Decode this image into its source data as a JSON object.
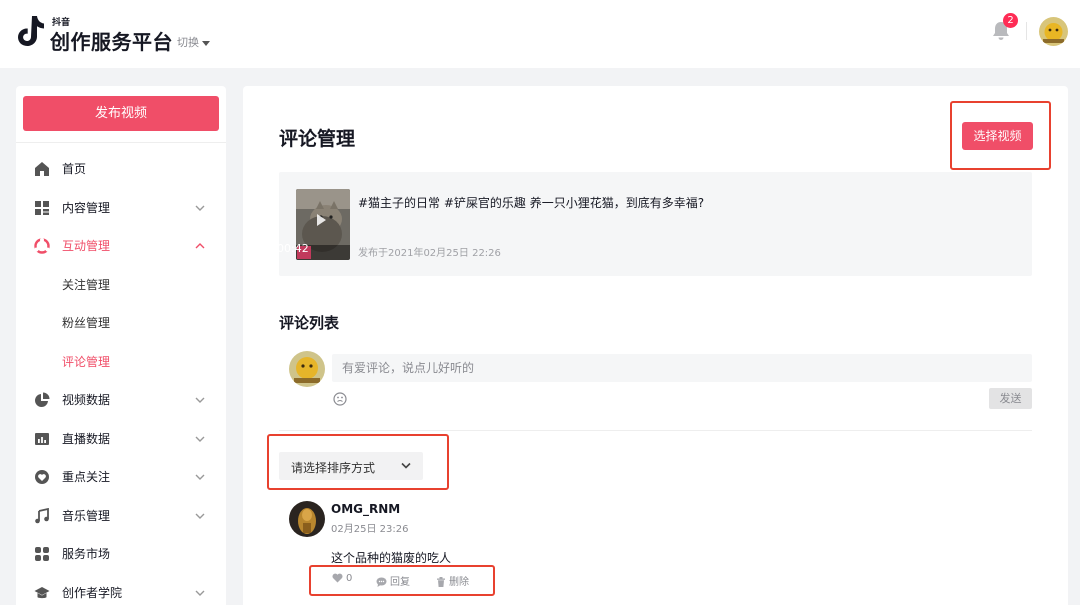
{
  "header": {
    "brand_small": "抖音",
    "brand": "创作服务平台",
    "switch_label": "切换",
    "notification_count": "2"
  },
  "sidebar": {
    "publish_label": "发布视频",
    "items": [
      {
        "label": "首页",
        "icon": "home-icon"
      },
      {
        "label": "内容管理",
        "icon": "grid-icon"
      },
      {
        "label": "互动管理",
        "icon": "interaction-icon"
      },
      {
        "label": "关注管理"
      },
      {
        "label": "粉丝管理"
      },
      {
        "label": "评论管理"
      },
      {
        "label": "视频数据",
        "icon": "pie-chart-icon"
      },
      {
        "label": "直播数据",
        "icon": "bar-chart-icon"
      },
      {
        "label": "重点关注",
        "icon": "heart-icon"
      },
      {
        "label": "音乐管理",
        "icon": "music-icon"
      },
      {
        "label": "服务市场",
        "icon": "apps-icon"
      },
      {
        "label": "创作者学院",
        "icon": "graduation-cap-icon"
      }
    ]
  },
  "main": {
    "page_title": "评论管理",
    "select_video_label": "选择视频",
    "video": {
      "title": "#猫主子的日常 #铲屎官的乐趣 养一只小狸花猫，到底有多幸福?",
      "date": "发布于2021年02月25日 22:26",
      "duration": "00:42"
    },
    "list_title": "评论列表",
    "comment_placeholder": "有爱评论，说点儿好听的",
    "send_label": "发送",
    "sort_placeholder": "请选择排序方式",
    "comment": {
      "user": "OMG_RNM",
      "time": "02月25日 23:26",
      "text": "这个品种的猫废的吃人",
      "likes": "0",
      "reply_label": "回复",
      "delete_label": "删除"
    }
  },
  "colors": {
    "accent": "#f04e68",
    "highlight_frame": "#e8412f"
  }
}
